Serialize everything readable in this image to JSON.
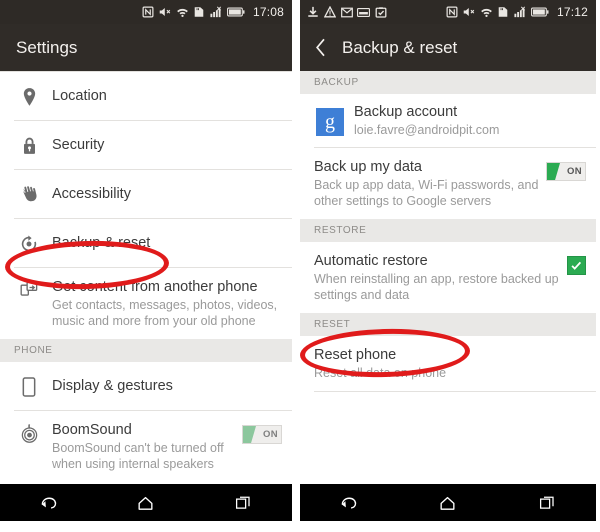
{
  "left_panel": {
    "status_bar": {
      "time": "17:08",
      "right_icons": [
        "nfc-icon",
        "volume-mute-icon",
        "wifi-icon",
        "sd-card-icon",
        "signal-bars-icon",
        "battery-icon"
      ],
      "left_icons": []
    },
    "title": "Settings",
    "items": [
      {
        "icon": "location-pin-icon",
        "title": "Location",
        "subtitle": ""
      },
      {
        "icon": "lock-icon",
        "title": "Security",
        "subtitle": ""
      },
      {
        "icon": "hand-icon",
        "title": "Accessibility",
        "subtitle": ""
      },
      {
        "icon": "backup-reset-icon",
        "title": "Backup & reset",
        "subtitle": ""
      },
      {
        "icon": "transfer-phone-icon",
        "title": "Get content from another phone",
        "subtitle": "Get contacts, messages, photos, videos, music and more from your old phone"
      }
    ],
    "section_phone": "PHONE",
    "phone_items": [
      {
        "icon": "phone-icon",
        "title": "Display & gestures",
        "subtitle": ""
      },
      {
        "icon": "boomsound-icon",
        "title": "BoomSound",
        "subtitle": "BoomSound can't be turned off when using internal speakers",
        "toggle": "ON"
      }
    ],
    "nav": [
      "back-icon",
      "home-icon",
      "recents-icon"
    ]
  },
  "right_panel": {
    "status_bar": {
      "time": "17:12",
      "left_icons": [
        "download-icon",
        "warning-icon",
        "mail-icon",
        "keyboard-icon",
        "task-check-icon"
      ],
      "right_icons": [
        "nfc-icon",
        "volume-mute-icon",
        "wifi-icon",
        "sd-card-icon",
        "signal-bars-icon",
        "battery-icon"
      ]
    },
    "title": "Backup & reset",
    "back_icon": "chevron-left-icon",
    "section_backup": "BACKUP",
    "backup_account": {
      "badge": "g",
      "title": "Backup account",
      "subtitle": "loie.favre@androidpit.com"
    },
    "backup_data": {
      "title": "Back up my data",
      "subtitle": "Back up app data, Wi-Fi passwords, and other settings to Google servers",
      "toggle": "ON"
    },
    "section_restore": "RESTORE",
    "auto_restore": {
      "title": "Automatic restore",
      "subtitle": "When reinstalling an app, restore backed up settings and data",
      "checked": true
    },
    "section_reset": "RESET",
    "reset_phone": {
      "title": "Reset phone",
      "subtitle": "Reset all data on phone"
    },
    "nav": [
      "back-icon",
      "home-icon",
      "recents-icon"
    ]
  },
  "annotations": {
    "highlight_1": "Backup & reset",
    "highlight_2": "Reset phone",
    "color": "#e01b1b"
  }
}
